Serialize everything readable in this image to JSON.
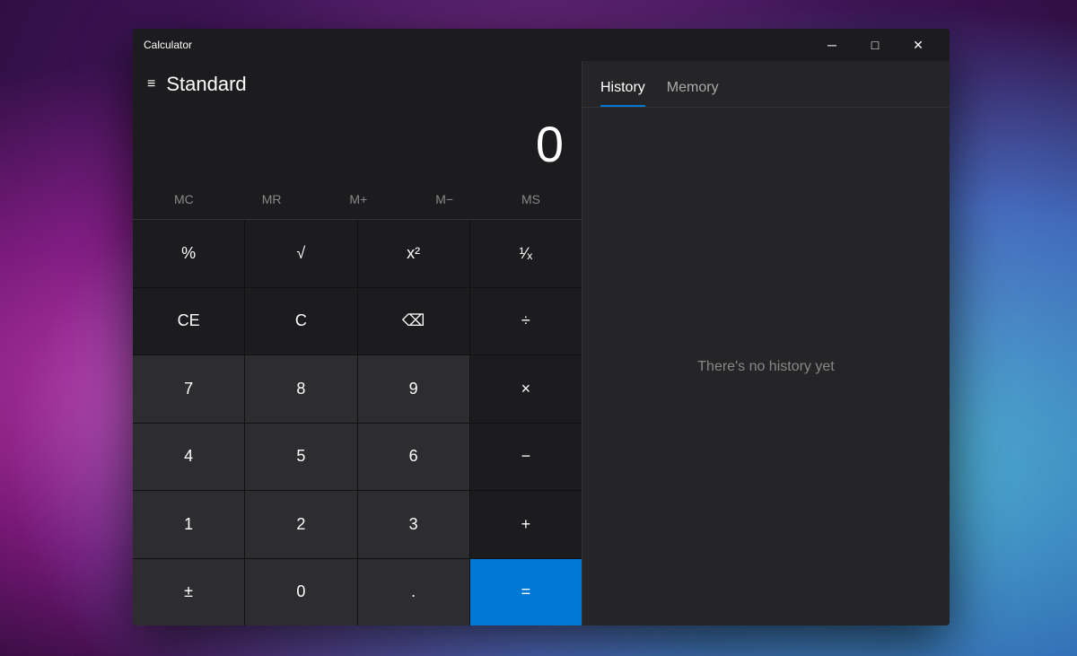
{
  "desktop": {},
  "window": {
    "title": "Calculator",
    "titlebar": {
      "minimize_label": "─",
      "maximize_label": "□",
      "close_label": "✕"
    }
  },
  "calc": {
    "mode": "Standard",
    "display": "0",
    "menu_icon": "≡",
    "memory_buttons": [
      "MC",
      "MR",
      "M+",
      "M−",
      "MS"
    ],
    "history_tab": "History",
    "memory_tab": "Memory",
    "no_history_text": "There's no history yet",
    "buttons": [
      {
        "label": "%",
        "type": "dark"
      },
      {
        "label": "√",
        "type": "dark"
      },
      {
        "label": "x²",
        "type": "dark"
      },
      {
        "label": "¹∕ₓ",
        "type": "dark"
      },
      {
        "label": "CE",
        "type": "dark"
      },
      {
        "label": "C",
        "type": "dark"
      },
      {
        "label": "⌫",
        "type": "dark"
      },
      {
        "label": "÷",
        "type": "dark"
      },
      {
        "label": "7",
        "type": "normal"
      },
      {
        "label": "8",
        "type": "normal"
      },
      {
        "label": "9",
        "type": "normal"
      },
      {
        "label": "×",
        "type": "dark"
      },
      {
        "label": "4",
        "type": "normal"
      },
      {
        "label": "5",
        "type": "normal"
      },
      {
        "label": "6",
        "type": "normal"
      },
      {
        "label": "−",
        "type": "dark"
      },
      {
        "label": "1",
        "type": "normal"
      },
      {
        "label": "2",
        "type": "normal"
      },
      {
        "label": "3",
        "type": "normal"
      },
      {
        "label": "+",
        "type": "dark"
      },
      {
        "label": "±",
        "type": "normal"
      },
      {
        "label": "0",
        "type": "normal"
      },
      {
        "label": ".",
        "type": "normal"
      },
      {
        "label": "=",
        "type": "equals"
      }
    ]
  }
}
